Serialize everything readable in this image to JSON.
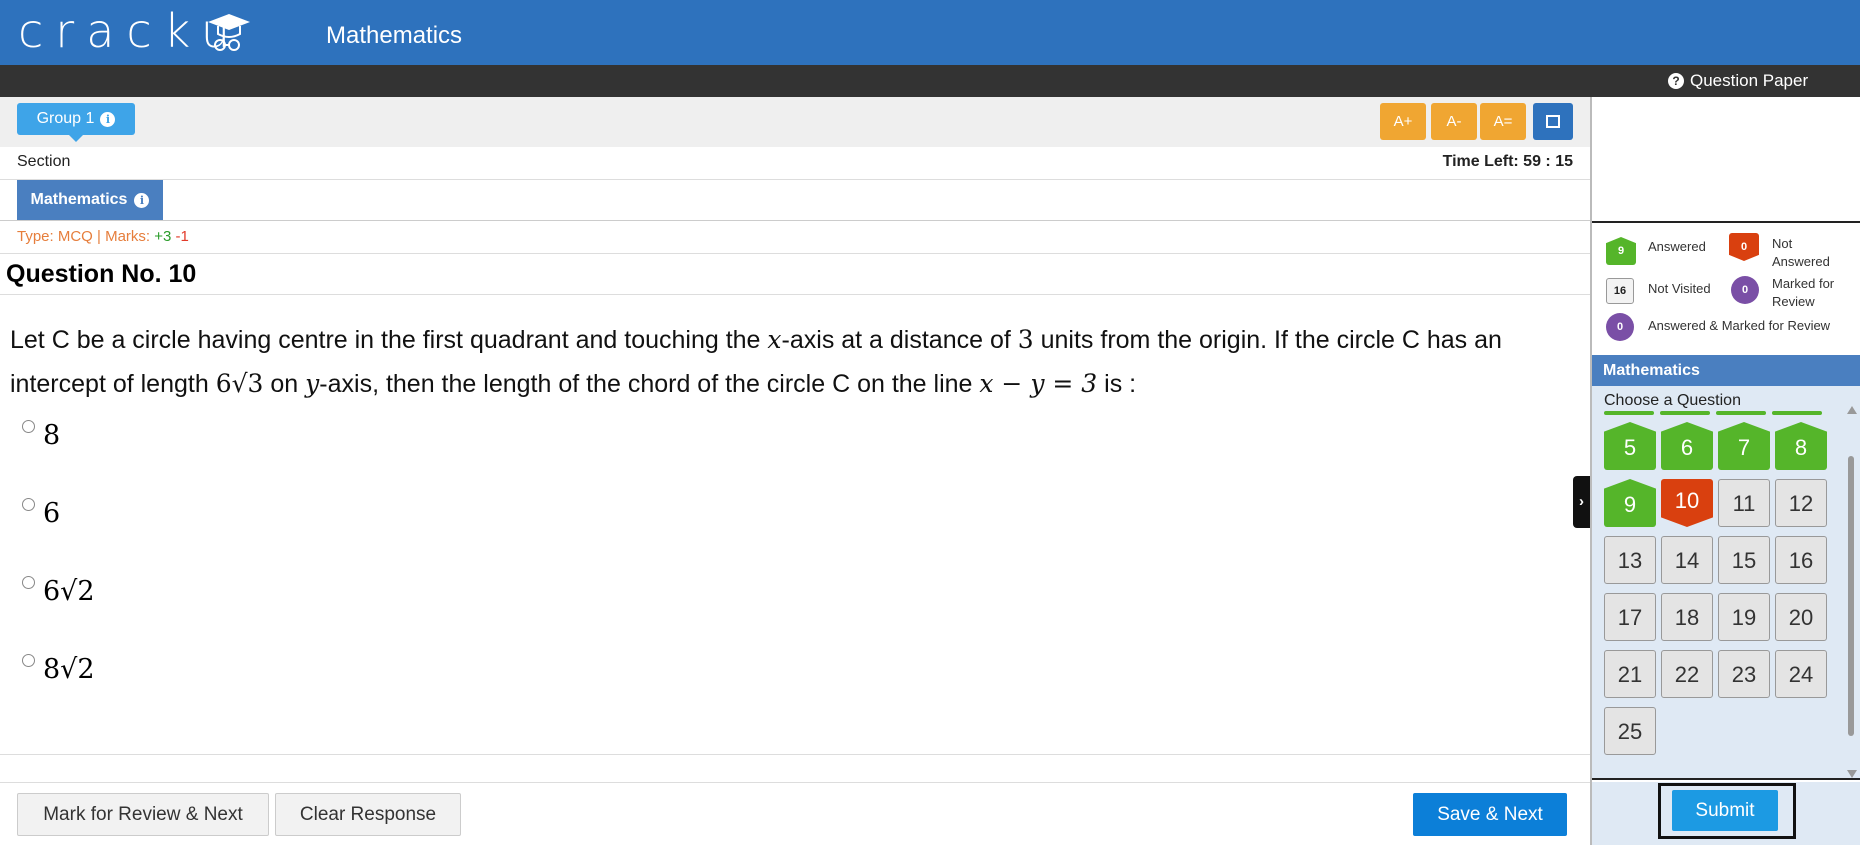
{
  "header": {
    "logo": "cracku",
    "subject": "Mathematics",
    "question_paper": "Question Paper"
  },
  "toolbar": {
    "group_label": "Group 1",
    "font_increase": "A+",
    "font_decrease": "A-",
    "font_reset": "A="
  },
  "section": {
    "label": "Section",
    "time_left": "Time Left: 59 : 15",
    "tab": "Mathematics"
  },
  "question": {
    "type_prefix": "Type: MCQ | Marks: ",
    "plus_marks": "+3",
    "minus_marks": "-1",
    "number_title": "Question No. 10",
    "text_part1": "Let C be a circle having centre in the first quadrant and touching the ",
    "x_var": "x",
    "text_part2": "-axis at a distance of ",
    "three": "3",
    "text_part3": " units from the origin. If the circle C has an intercept of length ",
    "six_root_three": "6√3",
    "text_part4": " on ",
    "y_var": "y",
    "text_part5": "-axis, then the length of the chord of the circle C on the line ",
    "line_eq": "x − y = 3",
    "text_part6": " is :",
    "options": [
      "8",
      "6",
      "6√2",
      "8√2"
    ]
  },
  "actions": {
    "mark_review": "Mark for Review & Next",
    "clear": "Clear Response",
    "save_next": "Save & Next",
    "submit": "Submit"
  },
  "legend": {
    "answered_count": "9",
    "answered_label": "Answered",
    "not_answered_count": "0",
    "not_answered_label": "Not Answered",
    "not_visited_count": "16",
    "not_visited_label": "Not Visited",
    "marked_count": "0",
    "marked_label": "Marked for Review",
    "answered_marked_count": "0",
    "answered_marked_label": "Answered & Marked for Review"
  },
  "palette": {
    "section_title": "Mathematics",
    "choose_label": "Choose a Question",
    "questions": [
      {
        "num": "5",
        "status": "answered"
      },
      {
        "num": "6",
        "status": "answered"
      },
      {
        "num": "7",
        "status": "answered"
      },
      {
        "num": "8",
        "status": "answered"
      },
      {
        "num": "9",
        "status": "answered"
      },
      {
        "num": "10",
        "status": "not-answered"
      },
      {
        "num": "11",
        "status": "not-visited"
      },
      {
        "num": "12",
        "status": "not-visited"
      },
      {
        "num": "13",
        "status": "not-visited"
      },
      {
        "num": "14",
        "status": "not-visited"
      },
      {
        "num": "15",
        "status": "not-visited"
      },
      {
        "num": "16",
        "status": "not-visited"
      },
      {
        "num": "17",
        "status": "not-visited"
      },
      {
        "num": "18",
        "status": "not-visited"
      },
      {
        "num": "19",
        "status": "not-visited"
      },
      {
        "num": "20",
        "status": "not-visited"
      },
      {
        "num": "21",
        "status": "not-visited"
      },
      {
        "num": "22",
        "status": "not-visited"
      },
      {
        "num": "23",
        "status": "not-visited"
      },
      {
        "num": "24",
        "status": "not-visited"
      },
      {
        "num": "25",
        "status": "not-visited"
      }
    ]
  },
  "colors": {
    "header_blue": "#2e72bd",
    "answered_green": "#55b52a",
    "not_answered_red": "#d9400f",
    "review_purple": "#7a4fa6",
    "font_button_orange": "#f0a632",
    "save_blue": "#0c7fd8"
  }
}
